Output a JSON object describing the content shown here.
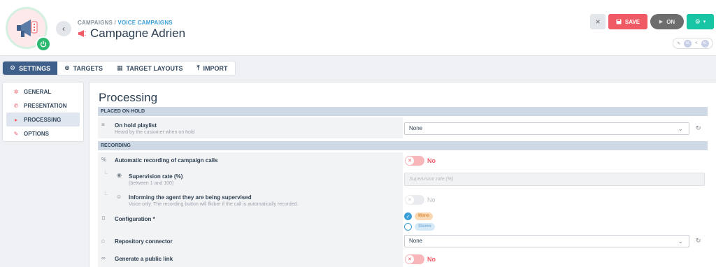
{
  "header": {
    "breadcrumb_root": "CAMPAIGNS",
    "breadcrumb_sep": "/",
    "breadcrumb_current": "VOICE CAMPAIGNS",
    "title": "Campagne Adrien",
    "buttons": {
      "close": "×",
      "save": "SAVE",
      "on": "ON"
    },
    "mini_badge_1": "AL",
    "mini_badge_2": "AL"
  },
  "tabs": [
    {
      "label": "SETTINGS",
      "icon": "gear-icon"
    },
    {
      "label": "TARGETS",
      "icon": "crosshair-icon"
    },
    {
      "label": "TARGET LAYOUTS",
      "icon": "grid-icon"
    },
    {
      "label": "IMPORT",
      "icon": "upload-icon"
    }
  ],
  "sidenav": [
    {
      "label": "GENERAL",
      "icon": "gear-icon"
    },
    {
      "label": "PRESENTATION",
      "icon": "phone-icon"
    },
    {
      "label": "PROCESSING",
      "icon": "play-icon"
    },
    {
      "label": "OPTIONS",
      "icon": "wrench-icon"
    }
  ],
  "main": {
    "title": "Processing",
    "sections": {
      "placed_on_hold": "PLACED ON HOLD",
      "recording": "RECORDING"
    },
    "on_hold_playlist": {
      "label": "On hold playlist",
      "sub": "Heard by the customer when on hold",
      "value": "None"
    },
    "auto_recording": {
      "label": "Automatic recording of campaign calls",
      "value": "No"
    },
    "supervision_rate": {
      "label": "Supervision rate (%)",
      "sub": "(between 1 and 100)",
      "placeholder": "Supervision rate (%)"
    },
    "informing_agent": {
      "label": "Informing the agent they are being supervised",
      "sub": "Voice only. The recording button will flicker if the call is automatically recorded.",
      "value": "No"
    },
    "configuration": {
      "label": "Configuration",
      "required": "*",
      "options": [
        {
          "label": "Mono",
          "checked": true
        },
        {
          "label": "Stereo",
          "checked": false
        }
      ]
    },
    "repository_connector": {
      "label": "Repository connector",
      "value": "None"
    },
    "public_link": {
      "label": "Generate a public link",
      "value": "No"
    }
  },
  "colors": {
    "accent_red": "#ef5a64",
    "teal": "#17c5a4",
    "nav_active": "#3d5f8a",
    "green": "#2eb872"
  }
}
